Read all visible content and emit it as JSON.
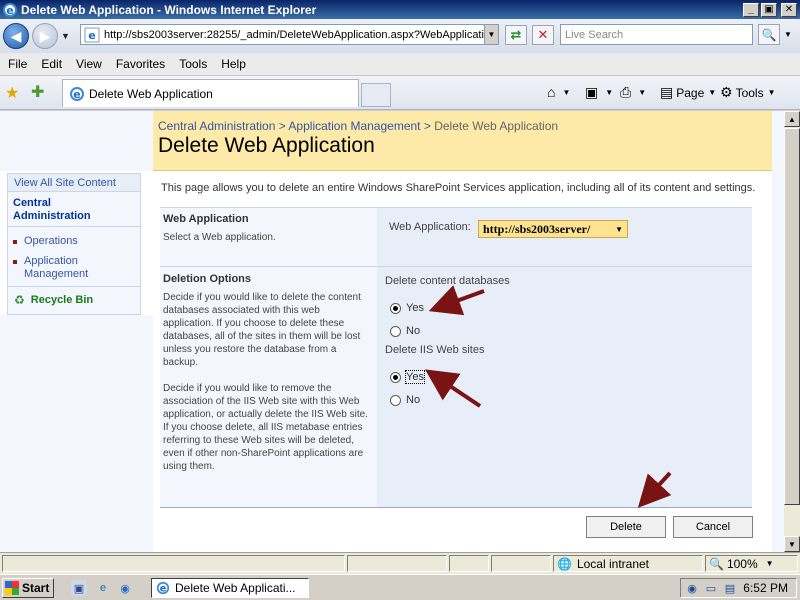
{
  "window": {
    "title": "Delete Web Application - Windows Internet Explorer",
    "minimize": "_",
    "maximize": "▣",
    "close": "✕"
  },
  "addressbar": {
    "url": "http://sbs2003server:28255/_admin/DeleteWebApplication.aspx?WebApplicati",
    "search_placeholder": "Live Search"
  },
  "menu": [
    "File",
    "Edit",
    "View",
    "Favorites",
    "Tools",
    "Help"
  ],
  "tab": {
    "title": "Delete Web Application"
  },
  "commandbar": {
    "page_label": "Page",
    "tools_label": "Tools"
  },
  "nav": {
    "view_all": "View All Site Content",
    "central_admin": "Central Administration",
    "links": [
      "Operations",
      "Application Management"
    ],
    "recycle_bin": "Recycle Bin"
  },
  "breadcrumb": {
    "root": "Central Administration",
    "sep": ">",
    "parent": "Application Management",
    "current": "Delete Web Application"
  },
  "page_title": "Delete Web Application",
  "intro": "This page allows you to delete an entire Windows SharePoint Services application, including all of its content and settings.",
  "section_webapp": {
    "title": "Web Application",
    "desc": "Select a Web application.",
    "field_label": "Web Application:",
    "selected": "http://sbs2003server/"
  },
  "section_deletion": {
    "title": "Deletion Options",
    "desc1": "Decide if you would like to delete the content databases associated with this web application.  If you choose to delete these databases, all of the sites in them will be lost unless you restore the database from a backup.",
    "desc2": "Decide if you would like to remove the association of the IIS Web site with this Web application, or actually delete the IIS Web site.  If you choose delete, all IIS metabase entries referring to these Web sites will be deleted, even if other non-SharePoint applications are using them.",
    "content_db_label": "Delete content databases",
    "iis_label": "Delete IIS Web sites",
    "yes": "Yes",
    "no": "No",
    "content_db_selected": "Yes",
    "iis_selected": "Yes"
  },
  "buttons": {
    "delete": "Delete",
    "cancel": "Cancel"
  },
  "status": {
    "zone": "Local intranet",
    "zoom": "100%"
  },
  "taskbar": {
    "start": "Start",
    "task_item": "Delete Web Applicati...",
    "clock": "6:52 PM"
  },
  "colors": {
    "accent": "#fde9a8",
    "arrow": "#7a1414",
    "link": "#3456a1"
  }
}
